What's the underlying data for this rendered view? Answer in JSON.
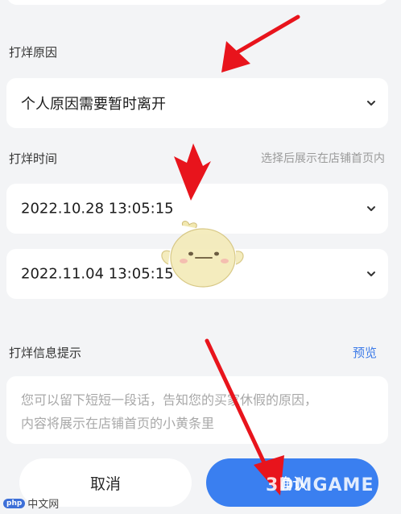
{
  "reason": {
    "label": "打烊原因",
    "value": "个人原因需要暂时离开"
  },
  "time": {
    "label": "打烊时间",
    "hint": "选择后展示在店铺首页内",
    "start": "2022.10.28 13:05:15",
    "end": "2022.11.04 13:05:15"
  },
  "info": {
    "label": "打烊信息提示",
    "preview": "预览",
    "placeholder_line1": "您可以留下短短一段话，告知您的买家休假的原因，",
    "placeholder_line2": "内容将展示在店铺首页的小黄条里"
  },
  "buttons": {
    "cancel": "取消",
    "confirm": "确认"
  },
  "watermarks": {
    "left_badge": "php",
    "left_text": "中文网",
    "right_text": "3DMGAME"
  },
  "icons": {
    "dropdown": "chevron-down-icon",
    "annotation": "red-arrow-icon",
    "mascot": "chick-mascot-icon"
  },
  "colors": {
    "accent": "#3a7ff0",
    "arrow": "#e8141c",
    "background": "#f3f4f6"
  }
}
